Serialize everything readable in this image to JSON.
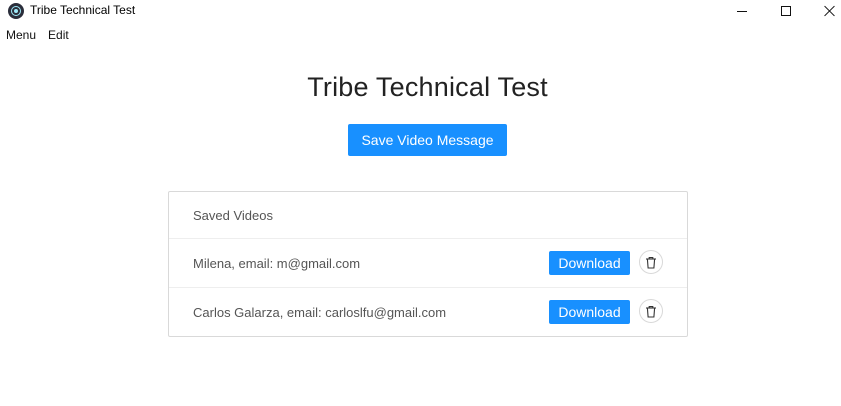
{
  "window": {
    "title": "Tribe Technical Test"
  },
  "menubar": {
    "items": [
      "Menu",
      "Edit"
    ]
  },
  "main": {
    "heading": "Tribe Technical Test",
    "save_button_label": "Save Video Message"
  },
  "saved_videos": {
    "header": "Saved Videos",
    "items": [
      {
        "text": "Milena, email: m@gmail.com",
        "download_label": "Download"
      },
      {
        "text": "Carlos Galarza, email: carloslfu@gmail.com",
        "download_label": "Download"
      }
    ]
  },
  "icons": {
    "app": "electron-icon",
    "minimize": "minimize-icon",
    "maximize": "maximize-icon",
    "close": "close-icon",
    "delete": "trash-icon"
  },
  "colors": {
    "primary": "#1890ff",
    "border": "#d9d9d9"
  }
}
